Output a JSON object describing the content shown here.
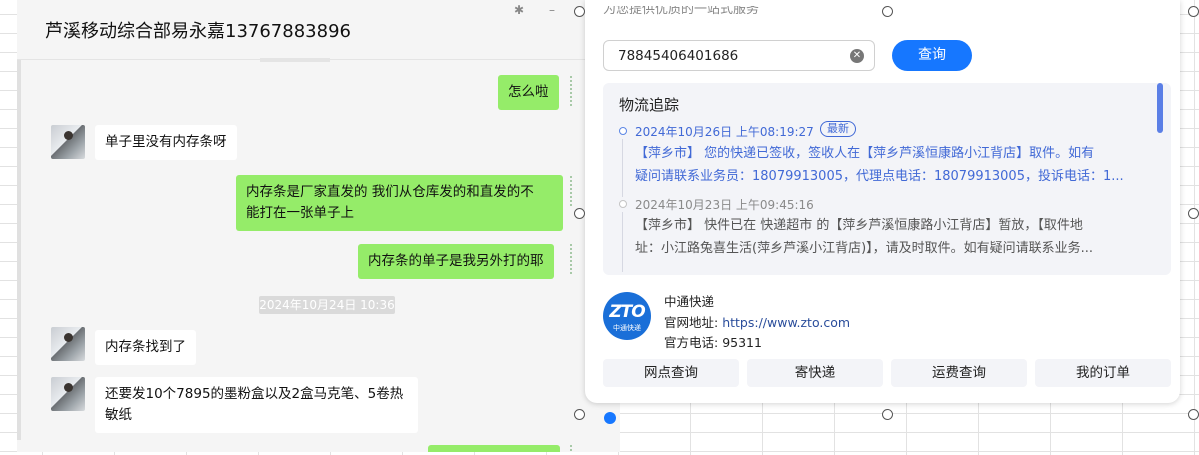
{
  "chat": {
    "title": "芦溪移动综合部易永嘉13767883896",
    "pin_icon": "pin-icon",
    "minimize_icon": "minimize-icon",
    "timestamp": "2024年10月24日 10:36",
    "messages": [
      {
        "side": "right",
        "text": "怎么啦"
      },
      {
        "side": "left",
        "text": "单子里没有内存条呀"
      },
      {
        "side": "right",
        "lines": [
          "内存条是厂家直发的  我们从仓库发的和直发的不",
          "能打在一张单子上"
        ]
      },
      {
        "side": "right",
        "text": "内存条的单子是我另外打的耶"
      },
      {
        "side": "left",
        "text": "内存条找到了"
      },
      {
        "side": "left",
        "lines": [
          "还要发10个7895的墨粉盒以及2盒马克笔、5卷热",
          "敏纸"
        ]
      }
    ]
  },
  "panel": {
    "top_text": "为您提供优质的一站式服务",
    "search": {
      "value": "78845406401686"
    },
    "query_button": "查询",
    "tracking": {
      "title": "物流追踪",
      "events": [
        {
          "time": "2024年10月26日 上午08:19:27",
          "badge": "最新",
          "lines": [
            "【萍乡市】 您的快递已签收，签收人在【萍乡芦溪恒康路小江背店】取件。如有",
            "疑问请联系业务员：18079913005，代理点电话：18079913005，投诉电话：1..."
          ]
        },
        {
          "time": "2024年10月23日 上午09:45:16",
          "lines": [
            "【萍乡市】 快件已在 快递超市 的【萍乡芦溪恒康路小江背店】暂放，【取件地",
            "址：小江路兔喜生活(萍乡芦溪小江背店)】，请及时取件。如有疑问请联系业务..."
          ]
        }
      ]
    },
    "company": {
      "logo_text": "ZTO",
      "logo_sub": "中通快递",
      "name": "中通快递",
      "site_label": "官网地址: ",
      "site_url": "https://www.zto.com",
      "phone_label": "官方电话:  ",
      "phone": "95311"
    },
    "actions": [
      "网点查询",
      "寄快递",
      "运费查询",
      "我的订单"
    ]
  },
  "colors": {
    "bubble_green": "#95ec69",
    "accent_blue": "#1677ff",
    "tracking_blue": "#4169d6"
  }
}
